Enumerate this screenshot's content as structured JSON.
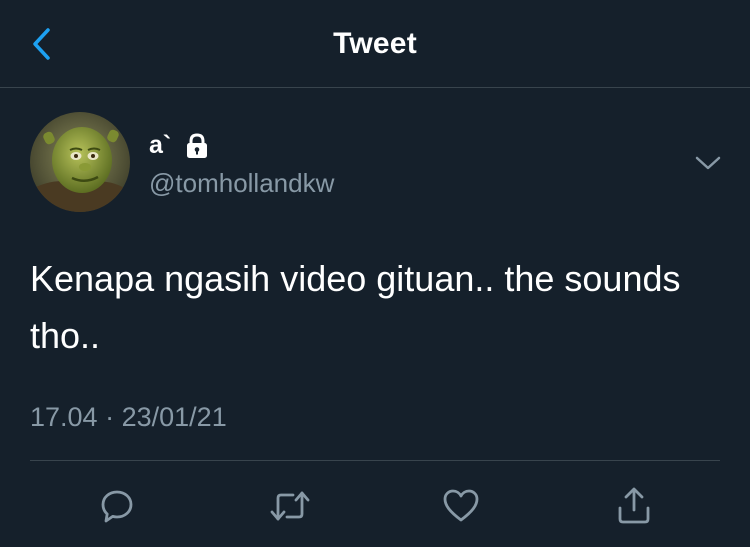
{
  "header": {
    "title": "Tweet",
    "back_icon": "chevron-left-icon",
    "accent": "#1da1f2"
  },
  "tweet": {
    "display_name": "a`",
    "handle": "@tomhollandkw",
    "protected_icon": "lock-icon",
    "text": "Kenapa ngasih video gituan.. the sounds tho..",
    "time": "17.04",
    "separator": "·",
    "date": "23/01/21"
  },
  "actions": [
    {
      "name": "reply",
      "icon": "reply-icon"
    },
    {
      "name": "retweet",
      "icon": "retweet-icon"
    },
    {
      "name": "like",
      "icon": "heart-icon"
    },
    {
      "name": "share",
      "icon": "share-icon"
    }
  ],
  "colors": {
    "background": "#15202b",
    "secondary_text": "#8899a6",
    "divider": "#38444d",
    "icon": "#8899a6"
  }
}
